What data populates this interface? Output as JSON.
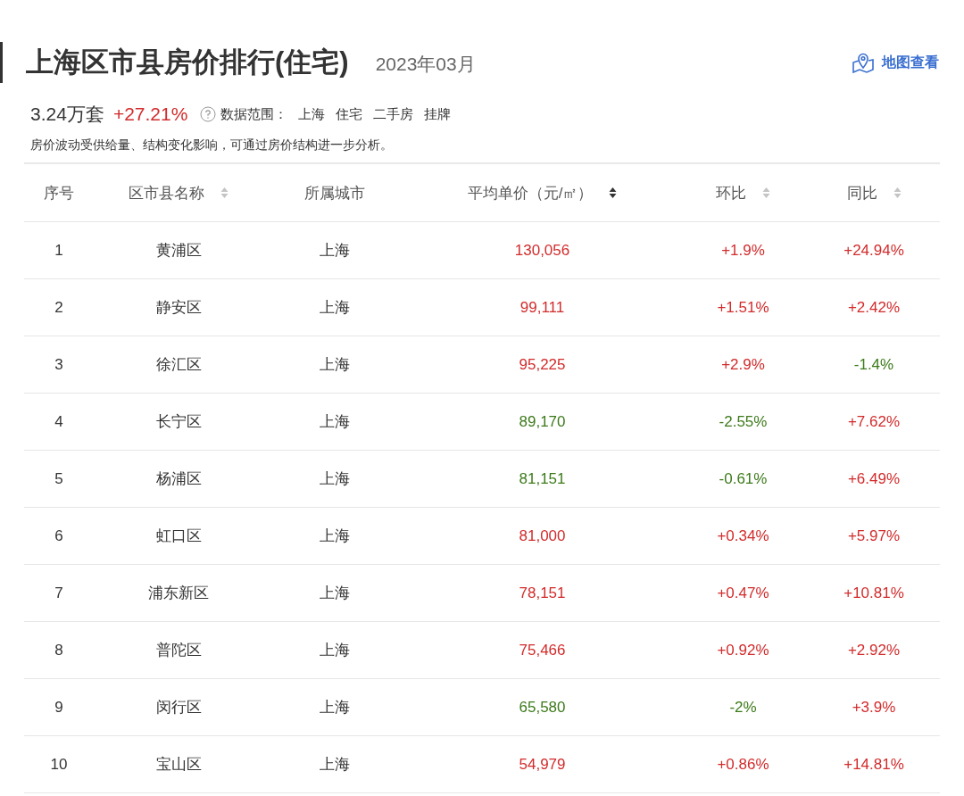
{
  "header": {
    "title": "上海区市县房价排行(住宅)",
    "date": "2023年03月",
    "map_link": "地图查看"
  },
  "summary": {
    "count": "3.24万套",
    "change": "+27.21%",
    "change_rising": true,
    "scope_label": "数据范围：",
    "scope": [
      "上海",
      "住宅",
      "二手房",
      "挂牌"
    ],
    "note": "房价波动受供给量、结构变化影响，可通过房价结构进一步分析。"
  },
  "table": {
    "columns": [
      {
        "label": "序号",
        "sortable": false
      },
      {
        "label": "区市县名称",
        "sortable": true,
        "sorted": false
      },
      {
        "label": "所属城市",
        "sortable": false
      },
      {
        "label": "平均单价（元/㎡）",
        "sortable": true,
        "sorted": true
      },
      {
        "label": "环比",
        "sortable": true,
        "sorted": false
      },
      {
        "label": "同比",
        "sortable": true,
        "sorted": false
      }
    ],
    "rows": [
      {
        "rank": "1",
        "name": "黄浦区",
        "city": "上海",
        "price": {
          "text": "130,056",
          "rising": true
        },
        "mom": {
          "text": "+1.9%",
          "rising": true
        },
        "yoy": {
          "text": "+24.94%",
          "rising": true
        }
      },
      {
        "rank": "2",
        "name": "静安区",
        "city": "上海",
        "price": {
          "text": "99,111",
          "rising": true
        },
        "mom": {
          "text": "+1.51%",
          "rising": true
        },
        "yoy": {
          "text": "+2.42%",
          "rising": true
        }
      },
      {
        "rank": "3",
        "name": "徐汇区",
        "city": "上海",
        "price": {
          "text": "95,225",
          "rising": true
        },
        "mom": {
          "text": "+2.9%",
          "rising": true
        },
        "yoy": {
          "text": "-1.4%",
          "rising": false
        }
      },
      {
        "rank": "4",
        "name": "长宁区",
        "city": "上海",
        "price": {
          "text": "89,170",
          "rising": false
        },
        "mom": {
          "text": "-2.55%",
          "rising": false
        },
        "yoy": {
          "text": "+7.62%",
          "rising": true
        }
      },
      {
        "rank": "5",
        "name": "杨浦区",
        "city": "上海",
        "price": {
          "text": "81,151",
          "rising": false
        },
        "mom": {
          "text": "-0.61%",
          "rising": false
        },
        "yoy": {
          "text": "+6.49%",
          "rising": true
        }
      },
      {
        "rank": "6",
        "name": "虹口区",
        "city": "上海",
        "price": {
          "text": "81,000",
          "rising": true
        },
        "mom": {
          "text": "+0.34%",
          "rising": true
        },
        "yoy": {
          "text": "+5.97%",
          "rising": true
        }
      },
      {
        "rank": "7",
        "name": "浦东新区",
        "city": "上海",
        "price": {
          "text": "78,151",
          "rising": true
        },
        "mom": {
          "text": "+0.47%",
          "rising": true
        },
        "yoy": {
          "text": "+10.81%",
          "rising": true
        }
      },
      {
        "rank": "8",
        "name": "普陀区",
        "city": "上海",
        "price": {
          "text": "75,466",
          "rising": true
        },
        "mom": {
          "text": "+0.92%",
          "rising": true
        },
        "yoy": {
          "text": "+2.92%",
          "rising": true
        }
      },
      {
        "rank": "9",
        "name": "闵行区",
        "city": "上海",
        "price": {
          "text": "65,580",
          "rising": false
        },
        "mom": {
          "text": "-2%",
          "rising": false
        },
        "yoy": {
          "text": "+3.9%",
          "rising": true
        }
      },
      {
        "rank": "10",
        "name": "宝山区",
        "city": "上海",
        "price": {
          "text": "54,979",
          "rising": true
        },
        "mom": {
          "text": "+0.86%",
          "rising": true
        },
        "yoy": {
          "text": "+14.81%",
          "rising": true
        }
      }
    ]
  }
}
